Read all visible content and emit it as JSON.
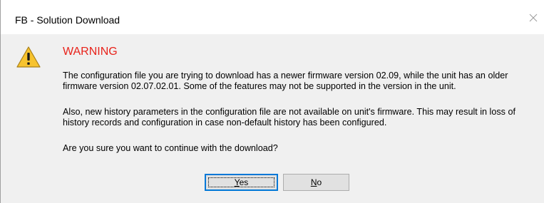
{
  "window": {
    "title": "FB - Solution Download",
    "close_glyph": "✕"
  },
  "message": {
    "icon": "warning-triangle-icon",
    "heading": "WARNING",
    "paragraph1": "The configuration file you are trying to download has a newer firmware version 02.09, while the unit has an older firmware version 02.07.02.01. Some of the features may not be supported in the version in the unit.",
    "paragraph2": "Also, new history parameters in the configuration file are not available on unit's firmware. This may result in loss of history records and configuration in case non-default history has been configured.",
    "question": "Are you sure you want to continue with the download?"
  },
  "buttons": {
    "yes_mnemonic": "Y",
    "yes_rest": "es",
    "no_mnemonic": "N",
    "no_rest": "o"
  },
  "colors": {
    "heading": "#e8231b",
    "content_bg": "#f0f0f0",
    "focus_border": "#0078d7",
    "icon_fill": "#f7c32e"
  }
}
